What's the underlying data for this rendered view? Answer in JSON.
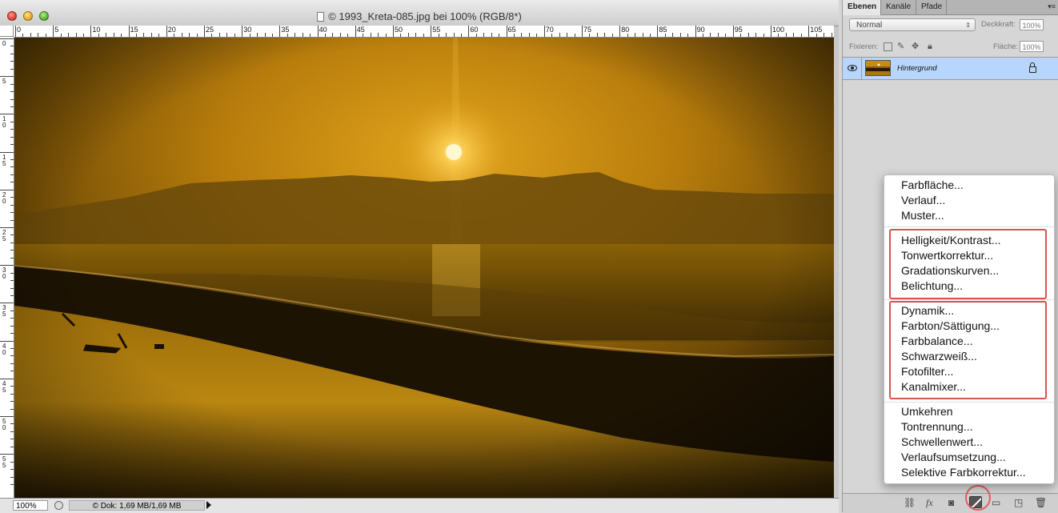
{
  "window": {
    "title": "© 1993_Kreta-085.jpg bei 100% (RGB/8*)"
  },
  "ruler_top": [
    "0",
    "5",
    "10",
    "15",
    "20",
    "25",
    "30",
    "35",
    "40",
    "45",
    "50",
    "55",
    "60",
    "65",
    "70",
    "75",
    "80",
    "85",
    "90",
    "95",
    "100",
    "105"
  ],
  "ruler_left": [
    "0",
    "5",
    "10",
    "15",
    "20",
    "25",
    "30",
    "35",
    "40",
    "45",
    "50",
    "55"
  ],
  "status": {
    "zoom": "100%",
    "doc_info": "© Dok: 1,69 MB/1,69 MB"
  },
  "panel": {
    "tabs": [
      "Ebenen",
      "Kanäle",
      "Pfade"
    ],
    "blend_mode": "Normal",
    "opacity_label": "Deckkraft:",
    "opacity_value": "100%",
    "lock_label": "Fixieren:",
    "fill_label": "Fläche:",
    "fill_value": "100%",
    "layer_name": "Hintergrund"
  },
  "adjustment_menu": {
    "group1": [
      "Farbfläche...",
      "Verlauf...",
      "Muster..."
    ],
    "group2": [
      "Helligkeit/Kontrast...",
      "Tonwertkorrektur...",
      "Gradationskurven...",
      "Belichtung..."
    ],
    "group3": [
      "Dynamik...",
      "Farbton/Sättigung...",
      "Farbbalance...",
      "Schwarzweiß...",
      "Fotofilter...",
      "Kanalmixer..."
    ],
    "group4": [
      "Umkehren",
      "Tontrennung...",
      "Schwellenwert...",
      "Verlaufsumsetzung...",
      "Selektive Farbkorrektur..."
    ]
  },
  "colors": {
    "highlight_box": "#d9534f",
    "layer_selected": "#b8d6fb",
    "sky_top": "#4a3305",
    "sun": "#fff3c0"
  }
}
